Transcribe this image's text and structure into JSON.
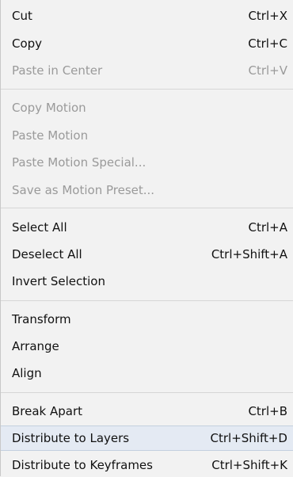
{
  "menu": {
    "items": [
      {
        "label": "Cut",
        "shortcut": "Ctrl+X",
        "enabled": true
      },
      {
        "label": "Copy",
        "shortcut": "Ctrl+C",
        "enabled": true
      },
      {
        "label": "Paste in Center",
        "shortcut": "Ctrl+V",
        "enabled": false
      },
      {
        "label": "Copy Motion",
        "shortcut": "",
        "enabled": false
      },
      {
        "label": "Paste Motion",
        "shortcut": "",
        "enabled": false
      },
      {
        "label": "Paste Motion Special...",
        "shortcut": "",
        "enabled": false
      },
      {
        "label": "Save as Motion Preset...",
        "shortcut": "",
        "enabled": false
      },
      {
        "label": "Select All",
        "shortcut": "Ctrl+A",
        "enabled": true
      },
      {
        "label": "Deselect All",
        "shortcut": "Ctrl+Shift+A",
        "enabled": true
      },
      {
        "label": "Invert Selection",
        "shortcut": "",
        "enabled": true
      },
      {
        "label": "Transform",
        "shortcut": "",
        "enabled": true
      },
      {
        "label": "Arrange",
        "shortcut": "",
        "enabled": true
      },
      {
        "label": "Align",
        "shortcut": "",
        "enabled": true
      },
      {
        "label": "Break Apart",
        "shortcut": "Ctrl+B",
        "enabled": true
      },
      {
        "label": "Distribute to Layers",
        "shortcut": "Ctrl+Shift+D",
        "enabled": true,
        "highlighted": true
      },
      {
        "label": "Distribute to Keyframes",
        "shortcut": "Ctrl+Shift+K",
        "enabled": true
      }
    ]
  },
  "colors": {
    "background": "#f2f2f2",
    "text": "#111111",
    "disabled_text": "#9a9a9a",
    "highlight": "#e4eaf3",
    "separator": "#d6d6d6"
  }
}
